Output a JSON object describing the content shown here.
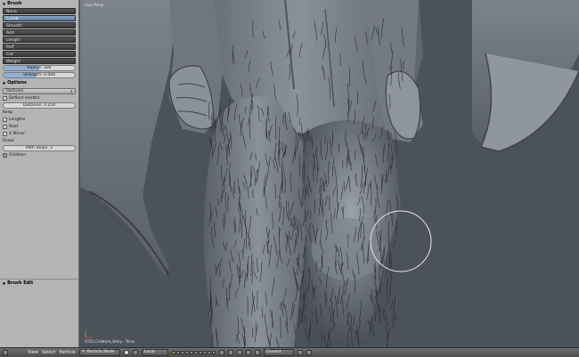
{
  "panel": {
    "brush_header": "Brush",
    "tools": [
      {
        "label": "None",
        "selected": false
      },
      {
        "label": "Comb",
        "selected": true
      },
      {
        "label": "Smooth",
        "selected": false
      },
      {
        "label": "Add",
        "selected": false
      },
      {
        "label": "Length",
        "selected": false
      },
      {
        "label": "Puff",
        "selected": false
      },
      {
        "label": "Cut",
        "selected": false
      },
      {
        "label": "Weight",
        "selected": false
      }
    ],
    "radius_label": "Radius: 100",
    "radius_value": 100,
    "strength_label": "Strength: 0.444",
    "strength_value": 0.444,
    "options_header": "Options",
    "mode_select": "Particles",
    "deflect_label": "Deflect emitter",
    "distance_label": "Distance: 0.250",
    "keep_label": "Keep",
    "keep_items": [
      {
        "label": "Lengths",
        "checked": true
      },
      {
        "label": "Root",
        "checked": true
      },
      {
        "label": "X Mirror",
        "checked": true
      }
    ],
    "draw_label": "Draw:",
    "path_steps_label": "Path Steps: 2",
    "children_label": "Children",
    "brush_edit_header": "Brush Edit"
  },
  "viewport": {
    "view_label": "User Persp",
    "status_text": "(151) Creature_Hairy : Torso"
  },
  "header": {
    "menus": [
      "View",
      "Select",
      "Particle"
    ],
    "mode": "Particle Mode",
    "orientation": "Local",
    "snap": "Closest"
  },
  "colors": {
    "accent_selected": "#6e8fb9",
    "panel_bg": "#b4b4b4",
    "viewport_bg": "#4c525a"
  }
}
